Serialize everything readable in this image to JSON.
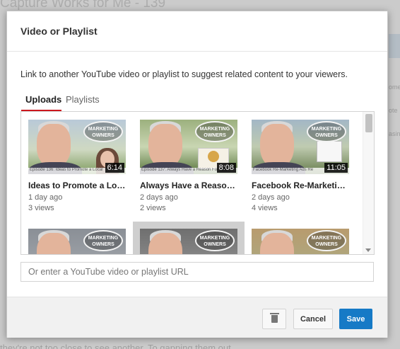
{
  "background": {
    "title": "Capture Works for Me - 139",
    "bottom_text": "they're not too close to see another. To gapping them out",
    "side_snippets": [
      "ome",
      "ote",
      "asin"
    ]
  },
  "dialog": {
    "title": "Video or Playlist",
    "description": "Link to another YouTube video or playlist to suggest related content to your viewers.",
    "tabs": [
      {
        "label": "Uploads",
        "active": true
      },
      {
        "label": "Playlists",
        "active": false
      }
    ],
    "videos": [
      {
        "title": "Ideas to Promote a Loc...",
        "age": "1 day ago",
        "views": "3 views",
        "duration": "6:14",
        "logo": "MARKETING OWNERS",
        "caption": "Episode 136: Ideas to Promote a Local"
      },
      {
        "title": "Always Have a Reason ...",
        "age": "2 days ago",
        "views": "2 views",
        "duration": "8:08",
        "logo": "MARKETING OWNERS",
        "caption": "Episode 137: Always Have a Reason For Text"
      },
      {
        "title": "Facebook Re-Marketin...",
        "age": "2 days ago",
        "views": "4 views",
        "duration": "11:05",
        "logo": "MARKETING OWNERS",
        "caption": "Facebook Re-Marketing Ads Re"
      },
      {
        "logo": "MARKETING OWNERS"
      },
      {
        "logo": "MARKETING OWNERS"
      },
      {
        "logo": "MARKETING OWNERS"
      }
    ],
    "url_placeholder": "Or enter a YouTube video or playlist URL",
    "buttons": {
      "delete_icon": "trash-icon",
      "cancel": "Cancel",
      "save": "Save"
    }
  },
  "colors": {
    "accent_red": "#cc181e",
    "save_blue": "#167ac6"
  }
}
